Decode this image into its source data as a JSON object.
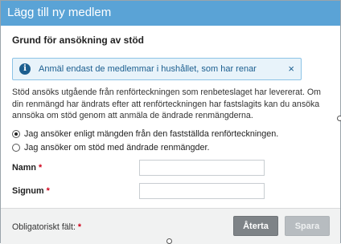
{
  "dialog": {
    "title": "Lägg till ny medlem",
    "section_title": "Grund för ansökning av stöd",
    "info": {
      "icon": "info-icon",
      "message": "Anmäl endast de medlemmar i hushållet, som har renar",
      "close_label": "×"
    },
    "description": "Stöd ansöks utgående från renförteckningen som renbeteslaget har levererat. Om din renmängd har ändrats efter att renförteckningen har fastslagits kan du ansöka annsöka om stöd genom att anmäla de ändrade renmängderna.",
    "options": [
      {
        "label": "Jag ansöker enligt mängden från den fastställda renförteckningen.",
        "checked": true
      },
      {
        "label": "Jag ansöker om stöd med ändrade renmängder.",
        "checked": false
      }
    ],
    "fields": {
      "name_label": "Namn",
      "name_value": "",
      "signum_label": "Signum",
      "signum_value": "",
      "required_mark": "*"
    },
    "footer": {
      "required_note": "Obligatoriskt fält:",
      "required_mark": "*",
      "back_label": "Återta",
      "save_label": "Spara"
    }
  },
  "colors": {
    "titlebar": "#5aa3d6",
    "info_bg": "#e8f3fa",
    "info_text": "#1b5e8f",
    "required": "#d0021b",
    "button_back": "#7e8387",
    "button_save_disabled": "#b7bcc0"
  }
}
